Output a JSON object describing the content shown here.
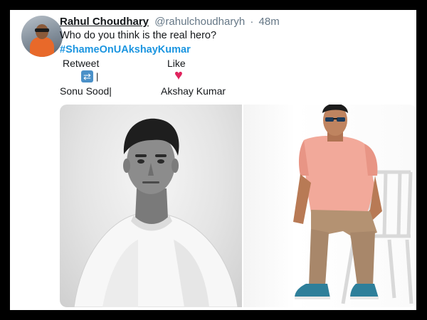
{
  "tweet": {
    "author_name": "Rahul Choudhary",
    "handle": "@rahulchoudharyh",
    "separator": "·",
    "time": "48m",
    "text": "Who do you think is the real hero?",
    "hashtag": "#ShameOnUAkshayKumar"
  },
  "poll": {
    "retweet_label": "Retweet",
    "like_label": "Like",
    "retweet_icon": "retweet-icon",
    "retweet_bar": "|",
    "like_icon": "heart-icon",
    "retweet_option": "Sonu Sood|",
    "like_option": "Akshay Kumar"
  },
  "colors": {
    "hashtag": "#1b95e0",
    "heart": "#e0245e",
    "retweet_icon": "#4a90c8",
    "frame": "#000000"
  }
}
